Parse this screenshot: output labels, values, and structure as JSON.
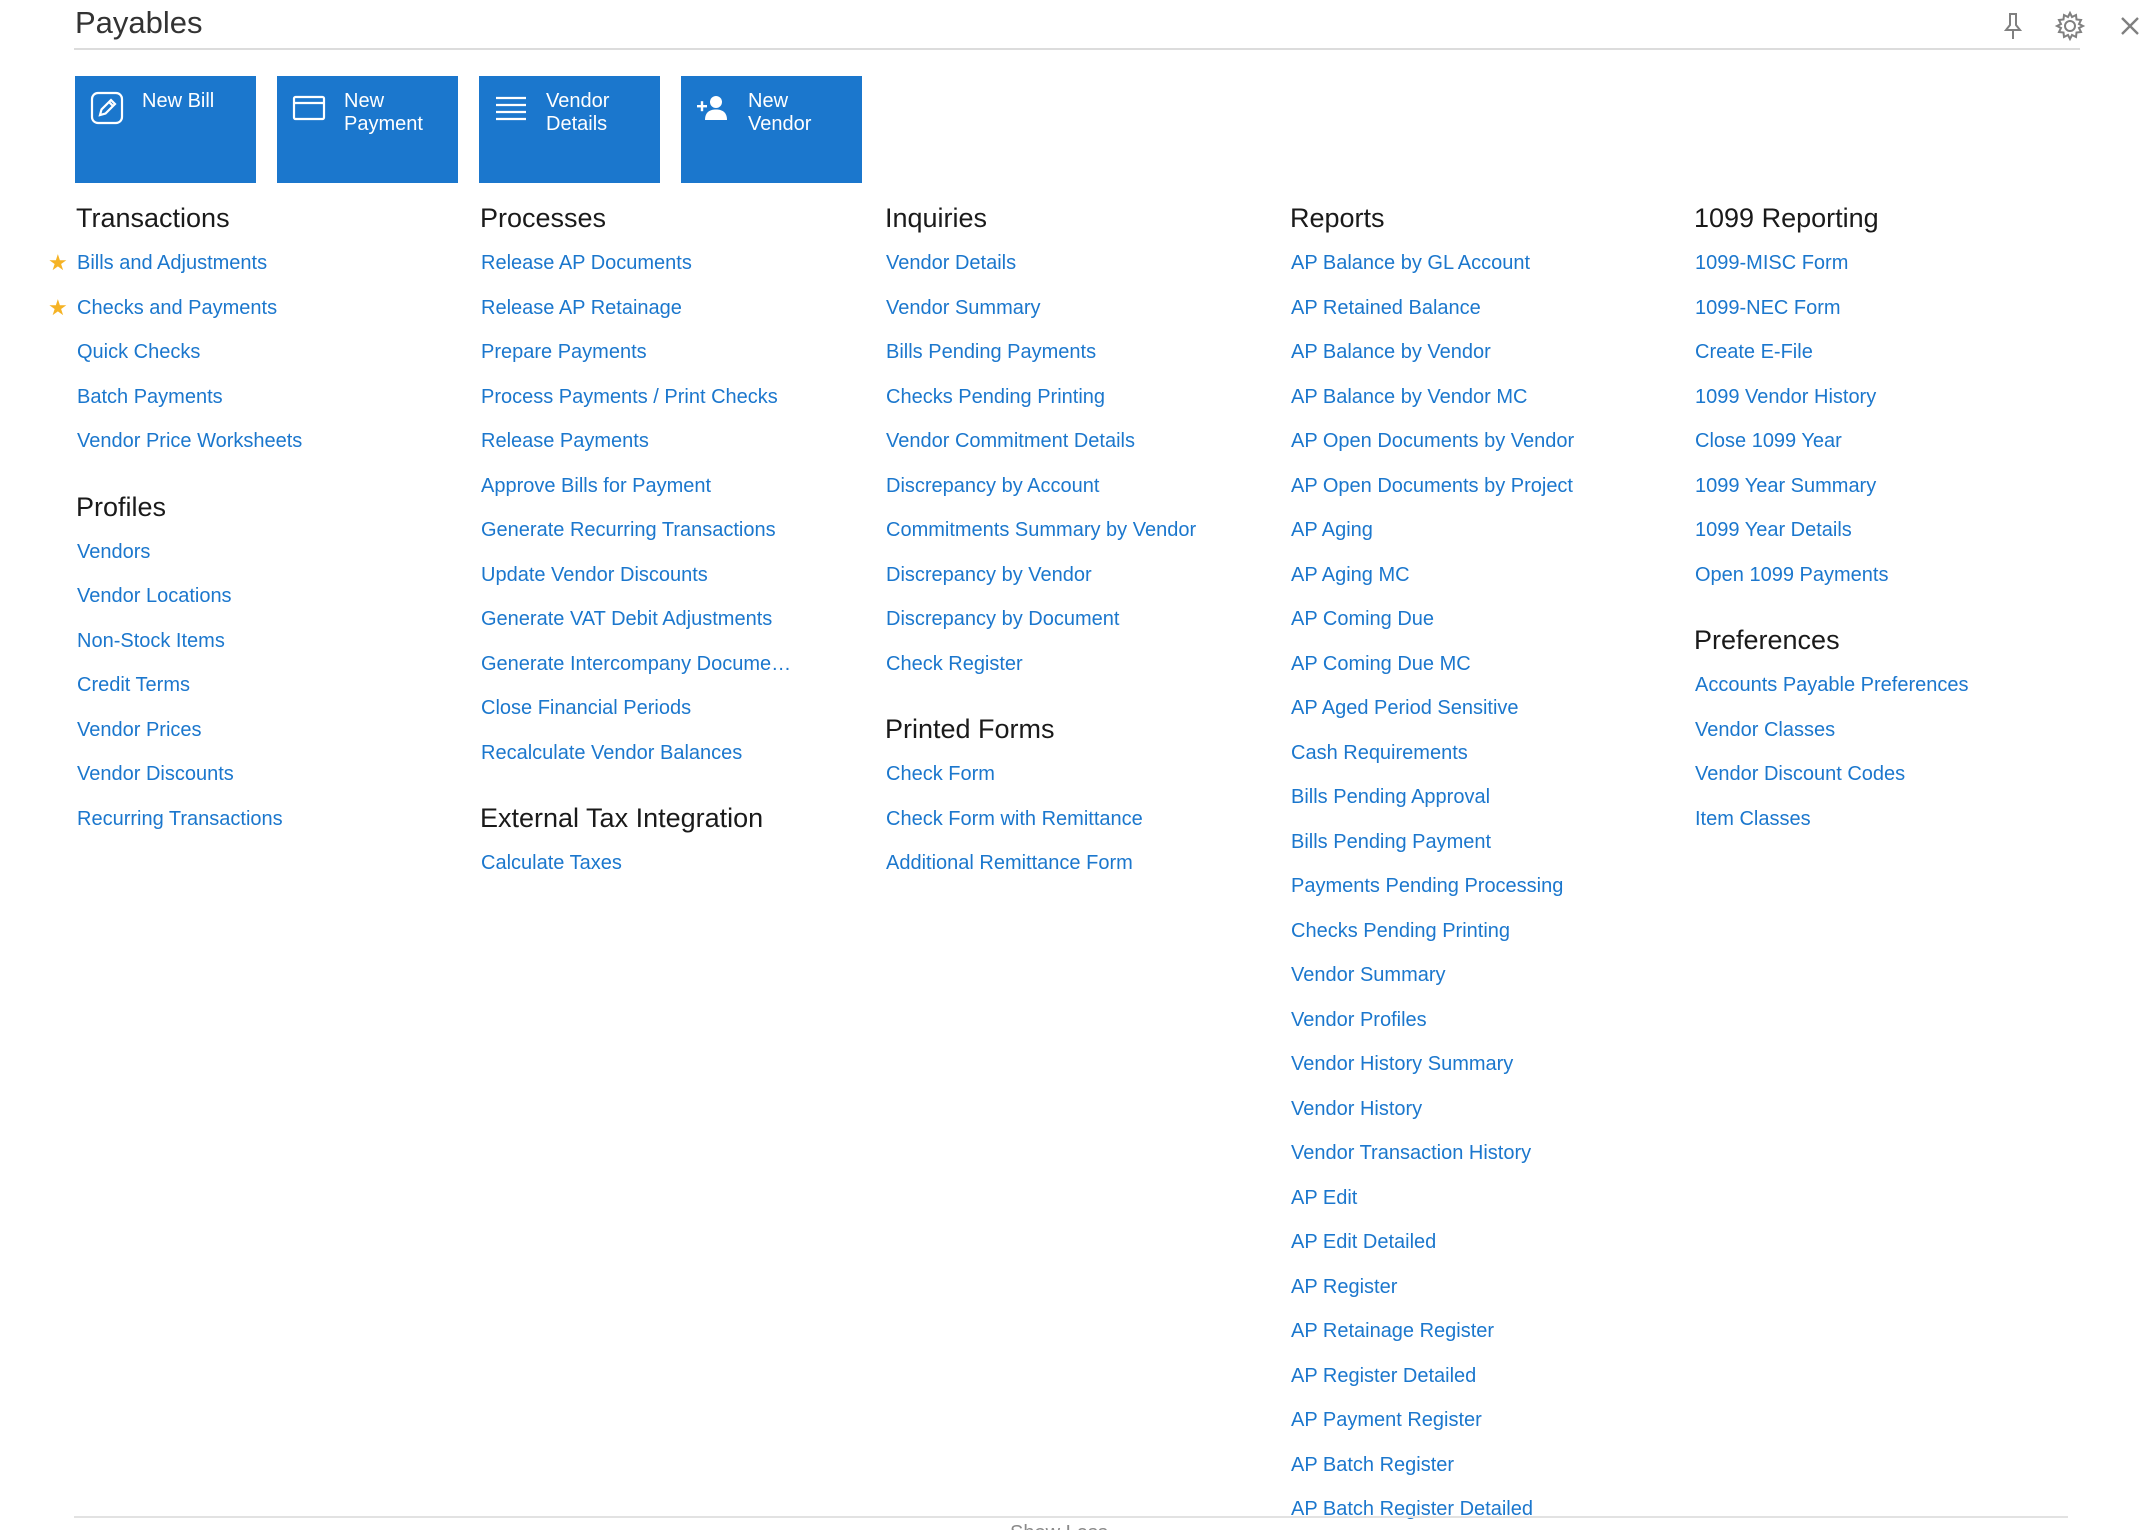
{
  "header": {
    "title": "Payables",
    "icons": [
      "pin-icon",
      "gear-icon",
      "close-icon"
    ]
  },
  "tiles": [
    {
      "label": "New Bill",
      "icon": "edit-icon"
    },
    {
      "label": "New Payment",
      "icon": "card-icon"
    },
    {
      "label": "Vendor Details",
      "icon": "list-icon"
    },
    {
      "label": "New Vendor",
      "icon": "add-person-icon"
    }
  ],
  "colors": {
    "accent": "#1b77cd",
    "star": "#f5b325",
    "heading": "#1a1a1a"
  },
  "columns": [
    {
      "sections": [
        {
          "title": "Transactions",
          "items": [
            {
              "label": "Bills and Adjustments",
              "favorite": true
            },
            {
              "label": "Checks and Payments",
              "favorite": true
            },
            {
              "label": "Quick Checks"
            },
            {
              "label": "Batch Payments"
            },
            {
              "label": "Vendor Price Worksheets"
            }
          ]
        },
        {
          "title": "Profiles",
          "items": [
            {
              "label": "Vendors"
            },
            {
              "label": "Vendor Locations"
            },
            {
              "label": "Non-Stock Items"
            },
            {
              "label": "Credit Terms"
            },
            {
              "label": "Vendor Prices"
            },
            {
              "label": "Vendor Discounts"
            },
            {
              "label": "Recurring Transactions"
            }
          ]
        }
      ]
    },
    {
      "sections": [
        {
          "title": "Processes",
          "items": [
            {
              "label": "Release AP Documents"
            },
            {
              "label": "Release AP Retainage"
            },
            {
              "label": "Prepare Payments"
            },
            {
              "label": "Process Payments / Print Checks"
            },
            {
              "label": "Release Payments"
            },
            {
              "label": "Approve Bills for Payment"
            },
            {
              "label": "Generate Recurring Transactions"
            },
            {
              "label": "Update Vendor Discounts"
            },
            {
              "label": "Generate VAT Debit Adjustments"
            },
            {
              "label": "Generate Intercompany Docume…"
            },
            {
              "label": "Close Financial Periods"
            },
            {
              "label": "Recalculate Vendor Balances"
            }
          ]
        },
        {
          "title": "External Tax Integration",
          "items": [
            {
              "label": "Calculate Taxes"
            }
          ]
        }
      ]
    },
    {
      "sections": [
        {
          "title": "Inquiries",
          "items": [
            {
              "label": "Vendor Details"
            },
            {
              "label": "Vendor Summary"
            },
            {
              "label": "Bills Pending Payments"
            },
            {
              "label": "Checks Pending Printing"
            },
            {
              "label": "Vendor Commitment Details"
            },
            {
              "label": "Discrepancy by Account"
            },
            {
              "label": "Commitments Summary by Vendor"
            },
            {
              "label": "Discrepancy by Vendor"
            },
            {
              "label": "Discrepancy by Document"
            },
            {
              "label": "Check Register"
            }
          ]
        },
        {
          "title": "Printed Forms",
          "items": [
            {
              "label": "Check Form"
            },
            {
              "label": "Check Form with Remittance"
            },
            {
              "label": "Additional Remittance Form"
            }
          ]
        }
      ]
    },
    {
      "sections": [
        {
          "title": "Reports",
          "items": [
            {
              "label": "AP Balance by GL Account"
            },
            {
              "label": "AP Retained Balance"
            },
            {
              "label": "AP Balance by Vendor"
            },
            {
              "label": "AP Balance by Vendor MC"
            },
            {
              "label": "AP Open Documents by Vendor"
            },
            {
              "label": "AP Open Documents by Project"
            },
            {
              "label": "AP Aging"
            },
            {
              "label": "AP Aging MC"
            },
            {
              "label": "AP Coming Due"
            },
            {
              "label": "AP Coming Due MC"
            },
            {
              "label": "AP Aged Period Sensitive"
            },
            {
              "label": "Cash Requirements"
            },
            {
              "label": "Bills Pending Approval"
            },
            {
              "label": "Bills Pending Payment"
            },
            {
              "label": "Payments Pending Processing"
            },
            {
              "label": "Checks Pending Printing"
            },
            {
              "label": "Vendor Summary"
            },
            {
              "label": "Vendor Profiles"
            },
            {
              "label": "Vendor History Summary"
            },
            {
              "label": "Vendor History"
            },
            {
              "label": "Vendor Transaction History"
            },
            {
              "label": "AP Edit"
            },
            {
              "label": "AP Edit Detailed"
            },
            {
              "label": "AP Register"
            },
            {
              "label": "AP Retainage Register"
            },
            {
              "label": "AP Register Detailed"
            },
            {
              "label": "AP Payment Register"
            },
            {
              "label": "AP Batch Register"
            },
            {
              "label": "AP Batch Register Detailed"
            }
          ]
        }
      ]
    },
    {
      "sections": [
        {
          "title": "1099 Reporting",
          "items": [
            {
              "label": "1099-MISC Form"
            },
            {
              "label": "1099-NEC Form"
            },
            {
              "label": "Create E-File"
            },
            {
              "label": "1099 Vendor History"
            },
            {
              "label": "Close 1099 Year"
            },
            {
              "label": "1099 Year Summary"
            },
            {
              "label": "1099 Year Details"
            },
            {
              "label": "Open 1099 Payments"
            }
          ]
        },
        {
          "title": "Preferences",
          "items": [
            {
              "label": "Accounts Payable Preferences"
            },
            {
              "label": "Vendor Classes"
            },
            {
              "label": "Vendor Discount Codes"
            },
            {
              "label": "Item Classes"
            }
          ]
        }
      ]
    }
  ],
  "footer": {
    "show_less_label": "Show Less"
  }
}
